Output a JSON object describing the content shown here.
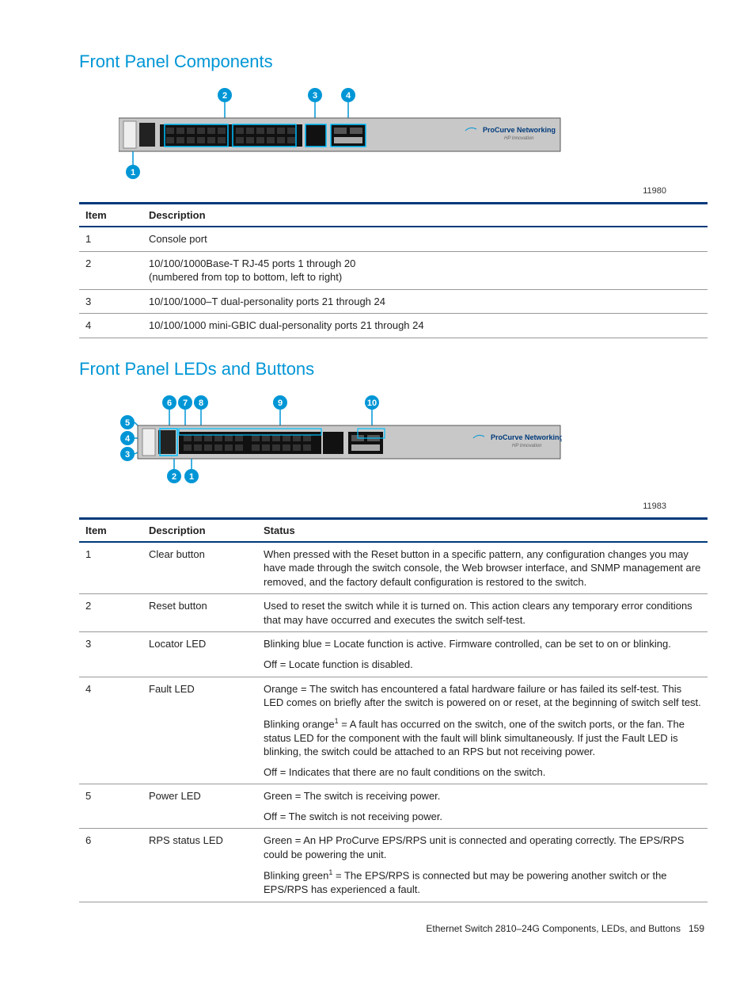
{
  "section1_title": "Front Panel Components",
  "fig1_id": "11980",
  "table1": {
    "headers": [
      "Item",
      "Description"
    ],
    "rows": [
      {
        "item": "1",
        "desc": "Console port"
      },
      {
        "item": "2",
        "desc": "10/100/1000Base-T RJ-45 ports 1 through 20\n(numbered from top to bottom, left to right)"
      },
      {
        "item": "3",
        "desc": "10/100/1000–T dual-personality ports 21 through 24"
      },
      {
        "item": "4",
        "desc": "10/100/1000 mini-GBIC dual-personality ports 21 through 24"
      }
    ]
  },
  "section2_title": "Front Panel LEDs and Buttons",
  "fig2_id": "11983",
  "table2": {
    "headers": [
      "Item",
      "Description",
      "Status"
    ],
    "rows": [
      {
        "item": "1",
        "desc": "Clear button",
        "status": [
          "When pressed with the Reset button in a specific pattern, any configuration changes you may have made through the switch console, the Web browser interface, and SNMP management are removed, and the factory default configuration is restored to the switch."
        ]
      },
      {
        "item": "2",
        "desc": "Reset button",
        "status": [
          "Used to reset the switch while it is turned on. This action clears any temporary error conditions that may have occurred and executes the switch self-test."
        ]
      },
      {
        "item": "3",
        "desc": "Locator LED",
        "status": [
          "Blinking blue = Locate function is active. Firmware controlled, can be set to on or blinking.",
          "Off = Locate function is disabled."
        ]
      },
      {
        "item": "4",
        "desc": "Fault LED",
        "status": [
          "Orange = The switch has encountered a fatal hardware failure or has failed its self-test. This LED comes on briefly after the switch is powered on or reset, at the beginning of switch self test.",
          "Blinking orange<sup>1</sup> = A fault has occurred on the switch, one of the switch ports, or the fan. The status LED for the component with the fault will blink simultaneously. If just the Fault LED is blinking, the switch could be attached to an RPS but not receiving power.",
          "Off = Indicates that there are no fault conditions on the switch."
        ]
      },
      {
        "item": "5",
        "desc": "Power LED",
        "status": [
          "Green = The switch is receiving power.",
          "Off = The switch is not receiving power."
        ]
      },
      {
        "item": "6",
        "desc": "RPS status LED",
        "status": [
          "Green = An HP ProCurve EPS/RPS unit is connected and operating correctly. The EPS/RPS could be powering the unit.",
          "Blinking green<sup>1</sup> = The EPS/RPS is connected but may be powering another switch or the EPS/RPS has experienced a fault."
        ]
      }
    ]
  },
  "callouts1": [
    "1",
    "2",
    "3",
    "4"
  ],
  "callouts2": [
    "1",
    "2",
    "3",
    "4",
    "5",
    "6",
    "7",
    "8",
    "9",
    "10"
  ],
  "brand_text": "ProCurve Networking",
  "footer": "Ethernet Switch 2810–24G Components, LEDs, and Buttons",
  "page_num": "159"
}
